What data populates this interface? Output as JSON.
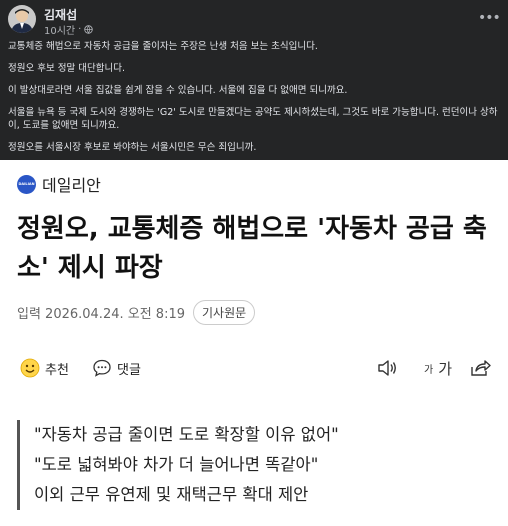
{
  "fb": {
    "author": "김재섭",
    "time": "10시간",
    "paragraphs": [
      "교통체증 해법으로 자동차 공급을 줄이자는 주장은 난생 처음 보는 초식입니다.",
      "정원오 후보 정말 대단합니다.",
      "이 발상대로라면 서울 집값을 쉽게 잡을 수 있습니다. 서울에 집을 다 없애면 되니까요.",
      "서울을 뉴욕 등 국제 도시와 경쟁하는 'G2' 도시로 만들겠다는 공약도 제시하셨는데, 그것도 바로 가능합니다. 런던이나 상하이, 도쿄를 없애면 되니까요.",
      "정원오를 서울시장 후보로 봐야하는 서울시민은 무슨 죄입니까."
    ]
  },
  "article": {
    "publisher": "데일리안",
    "headline": "정원오, 교통체증 해법으로 '자동차 공급 축소' 제시 파장",
    "date": "입력 2026.04.24. 오전 8:19",
    "original_button": "기사원문",
    "recommend_label": "추천",
    "comment_label": "댓글",
    "fontsize_small": "가",
    "fontsize_large": "가",
    "quotes": [
      "\"자동차 공급 줄이면 도로 확장할 이유 없어\"",
      "\"도로 넓혀봐야 차가 더 늘어나면 똑같아\"",
      "이외 근무 유연제 및 재택근무 확대 제안"
    ]
  },
  "icons": {
    "avatar": "avatar",
    "globe": "globe-icon",
    "more": "more-icon",
    "recommend": "smiley-icon",
    "comment": "speech-bubble-icon",
    "tts": "speaker-icon",
    "share": "share-icon"
  },
  "colors": {
    "fb_bg": "#242526",
    "fb_text": "#e4e6eb",
    "publisher_blue": "#2a56c6"
  }
}
